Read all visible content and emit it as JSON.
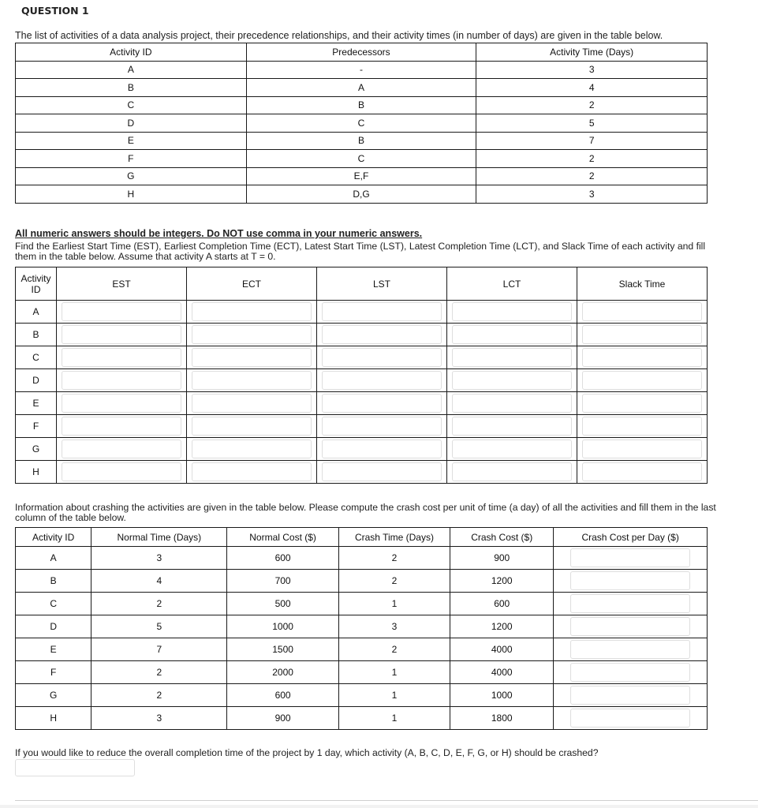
{
  "question_title": "QUESTION 1",
  "intro_text": "The list of activities of a data analysis project, their precedence relationships, and their activity times (in number of days) are given in the table below.",
  "activities_table": {
    "headers": [
      "Activity ID",
      "Predecessors",
      "Activity Time (Days)"
    ],
    "rows": [
      [
        "A",
        "-",
        "3"
      ],
      [
        "B",
        "A",
        "4"
      ],
      [
        "C",
        "B",
        "2"
      ],
      [
        "D",
        "C",
        "5"
      ],
      [
        "E",
        "B",
        "7"
      ],
      [
        "F",
        "C",
        "2"
      ],
      [
        "G",
        "E,F",
        "2"
      ],
      [
        "H",
        "D,G",
        "3"
      ]
    ]
  },
  "note_bold": "All numeric answers should be integers. Do NOT use comma in your numeric answers.",
  "instructions": "Find the Earliest Start Time (EST), Earliest Completion Time (ECT), Latest Start Time (LST), Latest Completion Time (LCT), and Slack Time of each activity and fill them in the table below. Assume that activity A starts at T = 0.",
  "schedule_table": {
    "headers": [
      "Activity ID",
      "EST",
      "ECT",
      "LST",
      "LCT",
      "Slack Time"
    ],
    "rows": [
      "A",
      "B",
      "C",
      "D",
      "E",
      "F",
      "G",
      "H"
    ],
    "input_values": {
      "A": [
        "",
        "",
        "",
        "",
        ""
      ],
      "B": [
        "",
        "",
        "",
        "",
        ""
      ],
      "C": [
        "",
        "",
        "",
        "",
        ""
      ],
      "D": [
        "",
        "",
        "",
        "",
        ""
      ],
      "E": [
        "",
        "",
        "",
        "",
        ""
      ],
      "F": [
        "",
        "",
        "",
        "",
        ""
      ],
      "G": [
        "",
        "",
        "",
        "",
        ""
      ],
      "H": [
        "",
        "",
        "",
        "",
        ""
      ]
    }
  },
  "crash_info_text": "Information about crashing the activities are given in the table below. Please compute the crash cost per unit of time (a day) of all the activities and fill them in the last column of the table below.",
  "crash_table": {
    "headers": [
      "Activity ID",
      "Normal Time (Days)",
      "Normal Cost ($)",
      "Crash Time (Days)",
      "Crash Cost ($)",
      "Crash Cost per Day ($)"
    ],
    "rows": [
      [
        "A",
        "3",
        "600",
        "2",
        "900"
      ],
      [
        "B",
        "4",
        "700",
        "2",
        "1200"
      ],
      [
        "C",
        "2",
        "500",
        "1",
        "600"
      ],
      [
        "D",
        "5",
        "1000",
        "3",
        "1200"
      ],
      [
        "E",
        "7",
        "1500",
        "2",
        "4000"
      ],
      [
        "F",
        "2",
        "2000",
        "1",
        "4000"
      ],
      [
        "G",
        "2",
        "600",
        "1",
        "1000"
      ],
      [
        "H",
        "3",
        "900",
        "1",
        "1800"
      ]
    ],
    "input_values": [
      "",
      "",
      "",
      "",
      "",
      "",
      "",
      ""
    ]
  },
  "final_question": "If you would like to reduce the overall completion time of the project by 1 day, which activity (A, B, C, D, E, F, G, or H) should be crashed?",
  "final_answer_value": ""
}
